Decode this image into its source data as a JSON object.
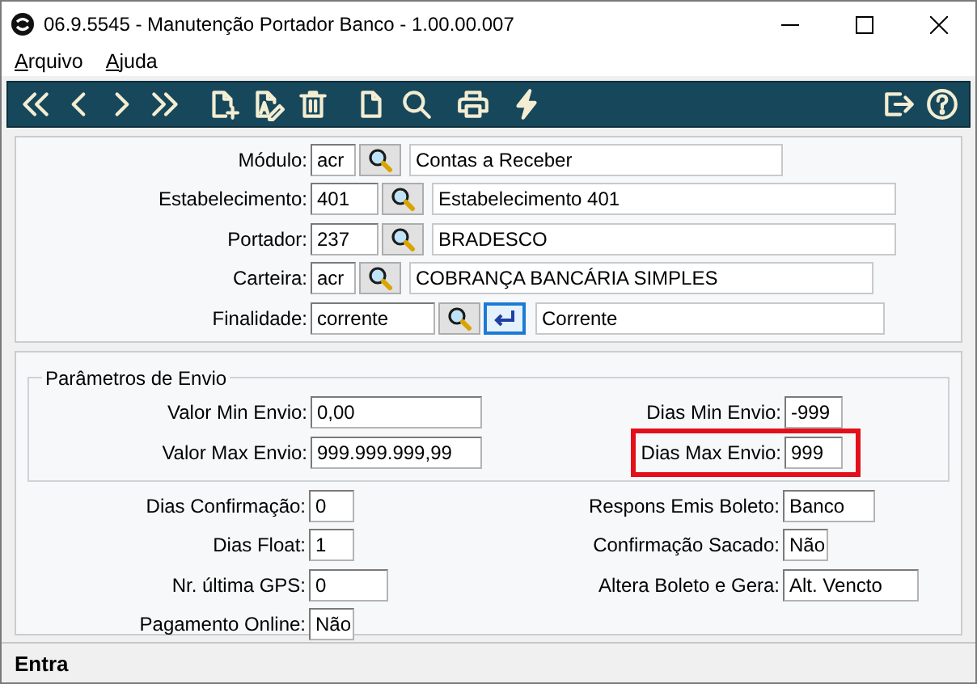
{
  "window": {
    "title": "06.9.5545 - Manutenção Portador Banco - 1.00.00.007"
  },
  "menu": [
    {
      "label": "Arquivo"
    },
    {
      "label": "Ajuda"
    }
  ],
  "header_fields": [
    {
      "label": "Módulo:",
      "code": "acr",
      "description": "Contas a Receber",
      "confirm_button": false
    },
    {
      "label": "Estabelecimento:",
      "code": "401",
      "description": "Estabelecimento 401",
      "confirm_button": false
    },
    {
      "label": "Portador:",
      "code": "237",
      "description": "BRADESCO",
      "confirm_button": false
    },
    {
      "label": "Carteira:",
      "code": "acr",
      "description": "COBRANÇA BANCÁRIA SIMPLES",
      "confirm_button": false
    },
    {
      "label": "Finalidade:",
      "code": "corrente",
      "description": "Corrente",
      "confirm_button": true
    }
  ],
  "send_parameters": {
    "title": "Parâmetros de Envio",
    "left": [
      {
        "label": "Valor Min Envio:",
        "value": "0,00"
      },
      {
        "label": "Valor Max Envio:",
        "value": "999.999.999,99"
      }
    ],
    "right": [
      {
        "label": "Dias Min Envio:",
        "value": "-999",
        "highlighted": false
      },
      {
        "label": "Dias Max Envio:",
        "value": "999",
        "highlighted": true
      }
    ]
  },
  "other_fields": {
    "left": [
      {
        "label": "Dias Confirmação:",
        "value": "0"
      },
      {
        "label": "Dias Float:",
        "value": "1"
      },
      {
        "label": "Nr. última GPS:",
        "value": "0"
      },
      {
        "label": "Pagamento Online:",
        "value": "Não"
      }
    ],
    "right": [
      {
        "label": "Respons Emis Boleto:",
        "value": "Banco"
      },
      {
        "label": "Confirmação Sacado:",
        "value": "Não"
      },
      {
        "label": "Altera Boleto e Gera:",
        "value": "Alt. Vencto"
      }
    ]
  },
  "status_bar": "Entra"
}
